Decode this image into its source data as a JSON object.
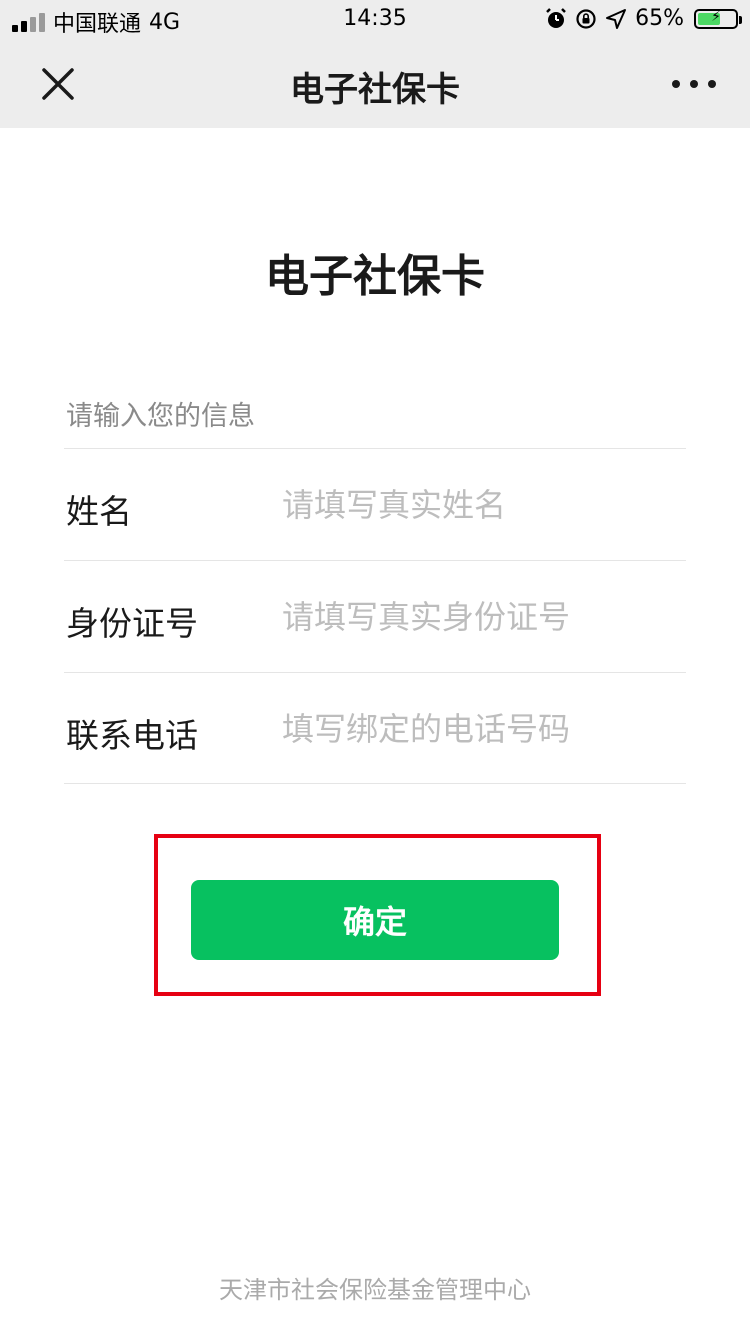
{
  "status_bar": {
    "carrier": "中国联通",
    "network": "4G",
    "time": "14:35",
    "battery_percent_text": "65%",
    "battery_level": 0.65
  },
  "nav": {
    "title": "电子社保卡"
  },
  "page": {
    "title": "电子社保卡",
    "section_label": "请输入您的信息"
  },
  "form": {
    "fields": [
      {
        "label": "姓名",
        "placeholder": "请填写真实姓名",
        "value": ""
      },
      {
        "label": "身份证号",
        "placeholder": "请填写真实身份证号",
        "value": ""
      },
      {
        "label": "联系电话",
        "placeholder": "填写绑定的电话号码",
        "value": ""
      }
    ],
    "confirm_label": "确定"
  },
  "footer": {
    "org": "天津市社会保险基金管理中心"
  },
  "colors": {
    "accent": "#07c160",
    "highlight": "#e60012",
    "nav_bg": "#ededed"
  }
}
